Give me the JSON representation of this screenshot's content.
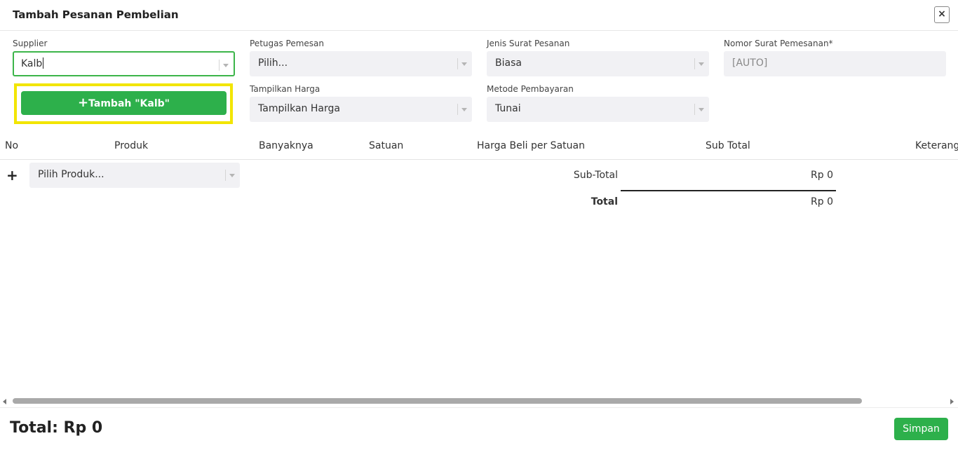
{
  "modal": {
    "title": "Tambah Pesanan Pembelian"
  },
  "form": {
    "supplier": {
      "label": "Supplier",
      "value": "Kalb"
    },
    "petugas": {
      "label": "Petugas Pemesan",
      "value": "Pilih..."
    },
    "jenis": {
      "label": "Jenis Surat Pesanan",
      "value": "Biasa"
    },
    "nomor": {
      "label": "Nomor Surat Pemesanan*",
      "value": "[AUTO]"
    },
    "tampilkan": {
      "label": "Tampilkan Harga",
      "value": "Tampilkan Harga"
    },
    "metode": {
      "label": "Metode Pembayaran",
      "value": "Tunai"
    }
  },
  "dropdown": {
    "add_label": "Tambah \"Kalb\"",
    "add_icon": "+"
  },
  "table": {
    "columns": [
      "No",
      "Produk",
      "Banyaknya",
      "Satuan",
      "Harga Beli per Satuan",
      "Sub Total",
      "Keterang"
    ],
    "add_row_icon": "+",
    "product_placeholder": "Pilih Produk..."
  },
  "summary": {
    "subtotal_label": "Sub-Total",
    "subtotal_value": "Rp 0",
    "total_label": "Total",
    "total_value": "Rp 0"
  },
  "footer": {
    "total_text": "Total: Rp 0",
    "save_label": "Simpan"
  },
  "colors": {
    "accent_green": "#2db04b",
    "highlight_yellow": "#f2e500",
    "input_bg": "#f1f1f4"
  }
}
